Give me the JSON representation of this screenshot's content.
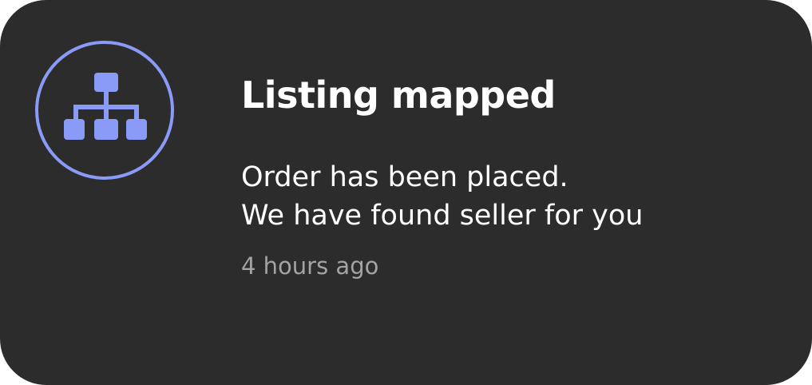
{
  "notification": {
    "icon": "sitemap-icon",
    "accent_color": "#8a9af7",
    "background_color": "#2c2c2c",
    "title": "Listing mapped",
    "message_line1": "Order has been placed.",
    "message_line2": "We have found seller for you",
    "timestamp": "4 hours ago"
  }
}
